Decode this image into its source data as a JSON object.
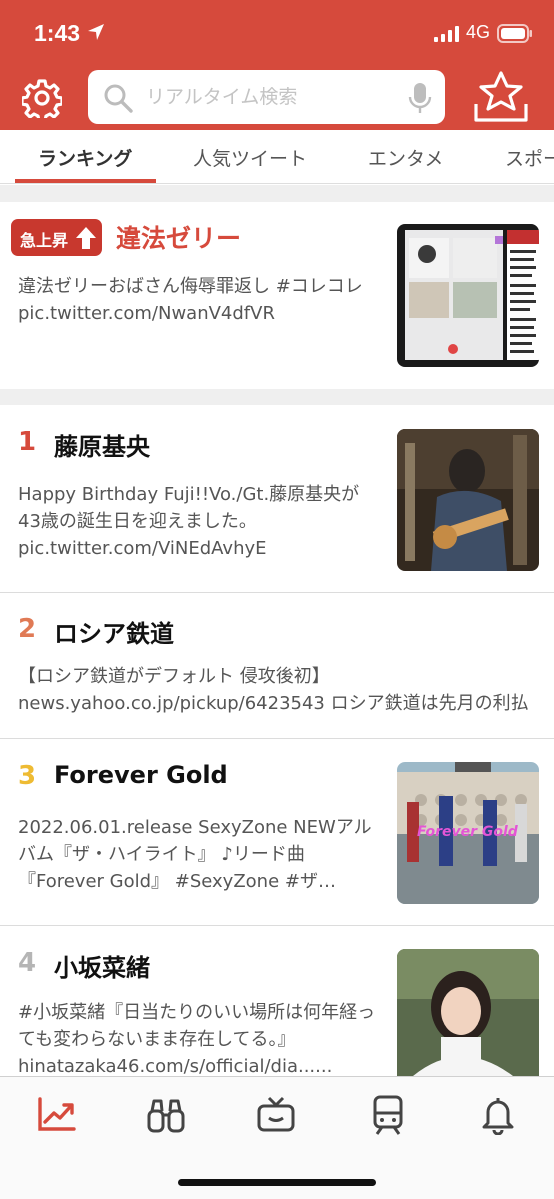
{
  "status_bar": {
    "time": "1:43",
    "network": "4G"
  },
  "search": {
    "placeholder": "リアルタイム検索"
  },
  "tabs": [
    {
      "label": "ランキング",
      "active": true
    },
    {
      "label": "人気ツイート",
      "active": false
    },
    {
      "label": "エンタメ",
      "active": false
    },
    {
      "label": "スポー",
      "active": false
    }
  ],
  "featured": {
    "badge": "急上昇",
    "title": "違法ゼリー",
    "description": "違法ゼリーおばさん侮辱罪返し #コレコレ pic.twitter.com/NwanV4dfVR"
  },
  "rankings": [
    {
      "rank": "1",
      "title": "藤原基央",
      "description": "Happy Birthday Fuji!!Vo./Gt.藤原基央が43歳の誕生日を迎えました。pic.twitter.com/ViNEdAvhyE",
      "color": "#d64a3c"
    },
    {
      "rank": "2",
      "title": "ロシア鉄道",
      "description": "【ロシア鉄道がデフォルト 侵攻後初】 news.yahoo.co.jp/pickup/6423543 ロシア鉄道は先月の利払いを行わず…",
      "color": "#e07a55"
    },
    {
      "rank": "3",
      "title": "Forever Gold",
      "description": "2022.06.01.release SexyZone NEWアルバム『ザ・ハイライト』 ♪リード曲『Forever Gold』 #SexyZone #ザ…",
      "color": "#eebb33",
      "thumb_text": "Forever Gold"
    },
    {
      "rank": "4",
      "title": "小坂菜緒",
      "description": "#小坂菜緒『日当たりのいい場所は何年経っても変わらないまま存在してる。』hinatazaka46.com/s/official/dia......",
      "color": "#b5b5b5"
    }
  ],
  "bottom_nav": [
    {
      "icon": "trend-chart-icon",
      "active": true
    },
    {
      "icon": "binoculars-icon",
      "active": false
    },
    {
      "icon": "tv-icon",
      "active": false
    },
    {
      "icon": "train-icon",
      "active": false
    },
    {
      "icon": "bell-icon",
      "active": false
    }
  ],
  "colors": {
    "brand": "#d64a3c",
    "badge": "#c8382e"
  }
}
